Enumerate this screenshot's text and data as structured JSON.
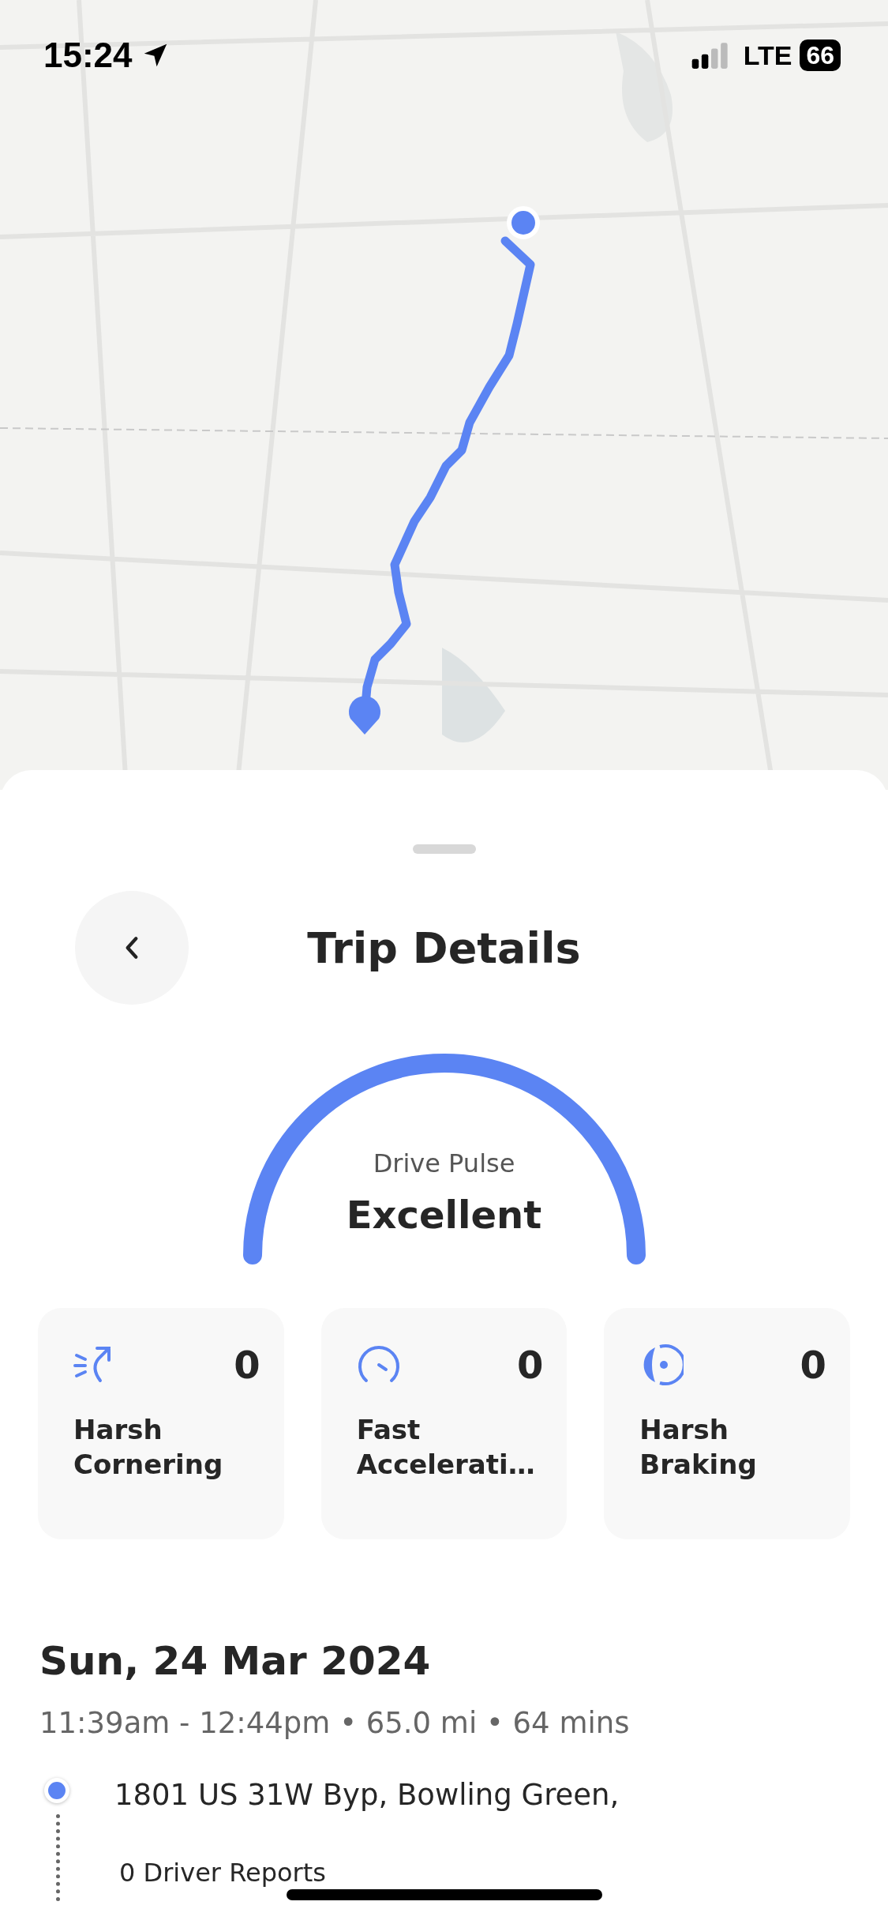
{
  "status_bar": {
    "time": "15:24",
    "network": "LTE",
    "battery": "66"
  },
  "sheet": {
    "title": "Trip Details"
  },
  "gauge": {
    "label": "Drive Pulse",
    "rating": "Excellent"
  },
  "stats": [
    {
      "kind": "cornering",
      "label": "Harsh Cornering",
      "count": "0"
    },
    {
      "kind": "acceleration",
      "label": "Fast Accelerati…",
      "count": "0"
    },
    {
      "kind": "braking",
      "label": "Harsh Braking",
      "count": "0"
    }
  ],
  "trip": {
    "date": "Sun, 24 Mar 2024",
    "summary": "11:39am - 12:44pm • 65.0 mi • 64 mins",
    "start_address": "1801 US 31W Byp, Bowling Green,",
    "reports": "0 Driver Reports"
  }
}
